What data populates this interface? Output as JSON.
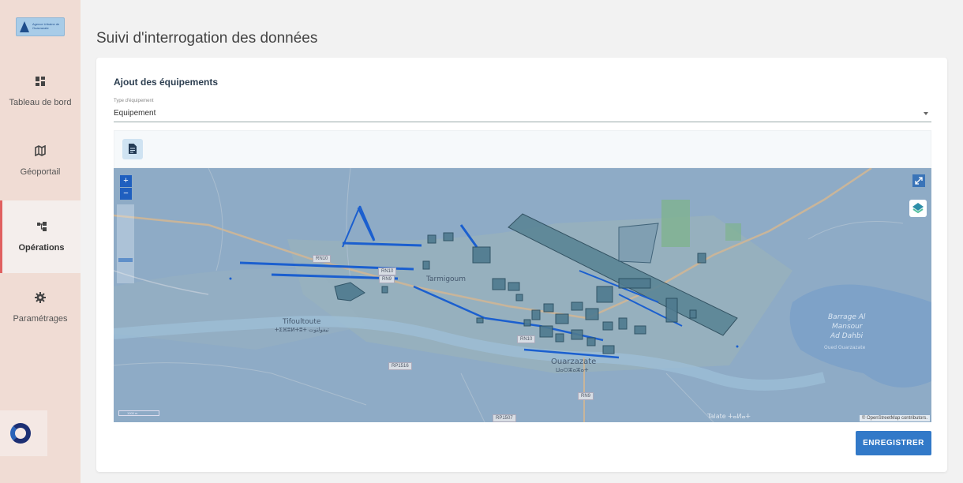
{
  "sidebar": {
    "logo_text": "Agence Urbaine de Ouarzazate",
    "items": [
      {
        "label": "Tableau de bord",
        "icon": "dashboard-icon"
      },
      {
        "label": "Géoportail",
        "icon": "map-icon"
      },
      {
        "label": "Opérations",
        "icon": "operations-icon",
        "active": true
      },
      {
        "label": "Paramétrages",
        "icon": "gear-icon"
      }
    ]
  },
  "header": {
    "title": "Suivi d'interrogation des données"
  },
  "form": {
    "section_title": "Ajout des équipements",
    "type_label": "Type d'équipement",
    "type_value": "Equipement"
  },
  "map": {
    "zoom_in": "+",
    "zoom_out": "−",
    "labels": {
      "tifoultoute": "Tifoultoute",
      "tifoultoute_ar": "ⵜⵉⴼⵓⵍⵜⵓⵜ تيفولتوت",
      "tarmigt": "Tarmigoum",
      "ouarzazate": "Ouarzazate",
      "ouarzazate_ar": "ⵡⴰⵔⵣⴰⵣⴰⵜ",
      "barrage1": "Barrage Al",
      "barrage2": "Mansour",
      "barrage3": "Ad Dahbi",
      "barrage_sub": "Oued Ouarzazate",
      "talate": "Talate ⵜⴰⵍⴰⵜ"
    },
    "road_tags": {
      "rn10a": "RN10",
      "rn10b": "RN10",
      "rn9": "RN9",
      "rn9b": "RN9",
      "rp1516": "RP1516",
      "rp1507": "RP1507",
      "rn10c": "RN10"
    },
    "scale": "1000 m",
    "attribution": "© OpenStreetMap contributors."
  },
  "actions": {
    "save": "ENREGISTRER"
  }
}
